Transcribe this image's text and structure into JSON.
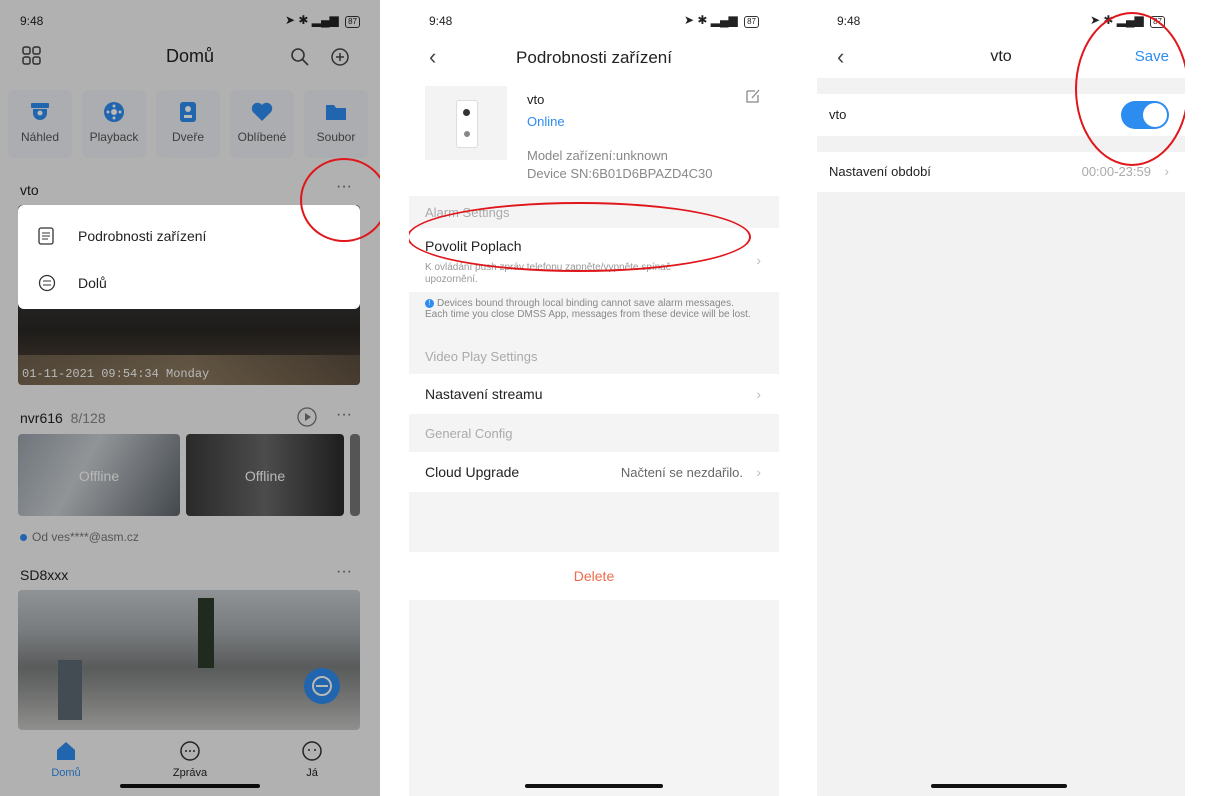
{
  "status": {
    "time": "9:48",
    "battery": "87"
  },
  "screen1": {
    "title": "Domů",
    "quick_actions": [
      {
        "label": "Náhled",
        "icon": "preview-camera-icon"
      },
      {
        "label": "Playback",
        "icon": "playback-icon"
      },
      {
        "label": "Dveře",
        "icon": "door-icon"
      },
      {
        "label": "Oblíbené",
        "icon": "heart-icon"
      },
      {
        "label": "Soubor",
        "icon": "folder-icon"
      }
    ],
    "device1": {
      "name": "vto",
      "more": "···",
      "timestamp": "01-11-2021 09:54:34 Monday"
    },
    "menu": {
      "item1": "Podrobnosti zařízení",
      "item2": "Dolů"
    },
    "device2": {
      "name": "nvr616",
      "count": "8/128",
      "more": "···",
      "offline1": "Offline",
      "offline2": "Offline"
    },
    "shared_from": "Od ves****@asm.cz",
    "device3": {
      "name": "SD8xxx",
      "more": "···"
    },
    "bottom_nav": [
      {
        "label": "Domů"
      },
      {
        "label": "Zpráva"
      },
      {
        "label": "Já"
      }
    ]
  },
  "screen2": {
    "title": "Podrobnosti zařízení",
    "device_name": "vto",
    "status": "Online",
    "model": "Model zařízení:unknown",
    "sn": "Device SN:6B01D6BPAZD4C30",
    "alarm_settings": "Alarm Settings",
    "povolit": "Povolit Poplach",
    "povolit_desc": "K ovládání push zpráv telefonu zapněte/vypněte spínač upozornění.",
    "notice": "Devices bound through local binding cannot save alarm messages. Each time you close DMSS App, messages from these device will be lost.",
    "video_settings": "Video Play Settings",
    "stream": "Nastavení streamu",
    "general": "General Config",
    "cloud": "Cloud Upgrade",
    "cloud_value": "Načtení se nezdařilo.",
    "delete": "Delete"
  },
  "screen3": {
    "title": "vto",
    "save": "Save",
    "row1_label": "vto",
    "period_label": "Nastavení období",
    "period_value": "00:00-23:59"
  },
  "colors": {
    "accent": "#2d8cf0",
    "danger": "#e0161b",
    "delete": "#ee6b4b"
  }
}
